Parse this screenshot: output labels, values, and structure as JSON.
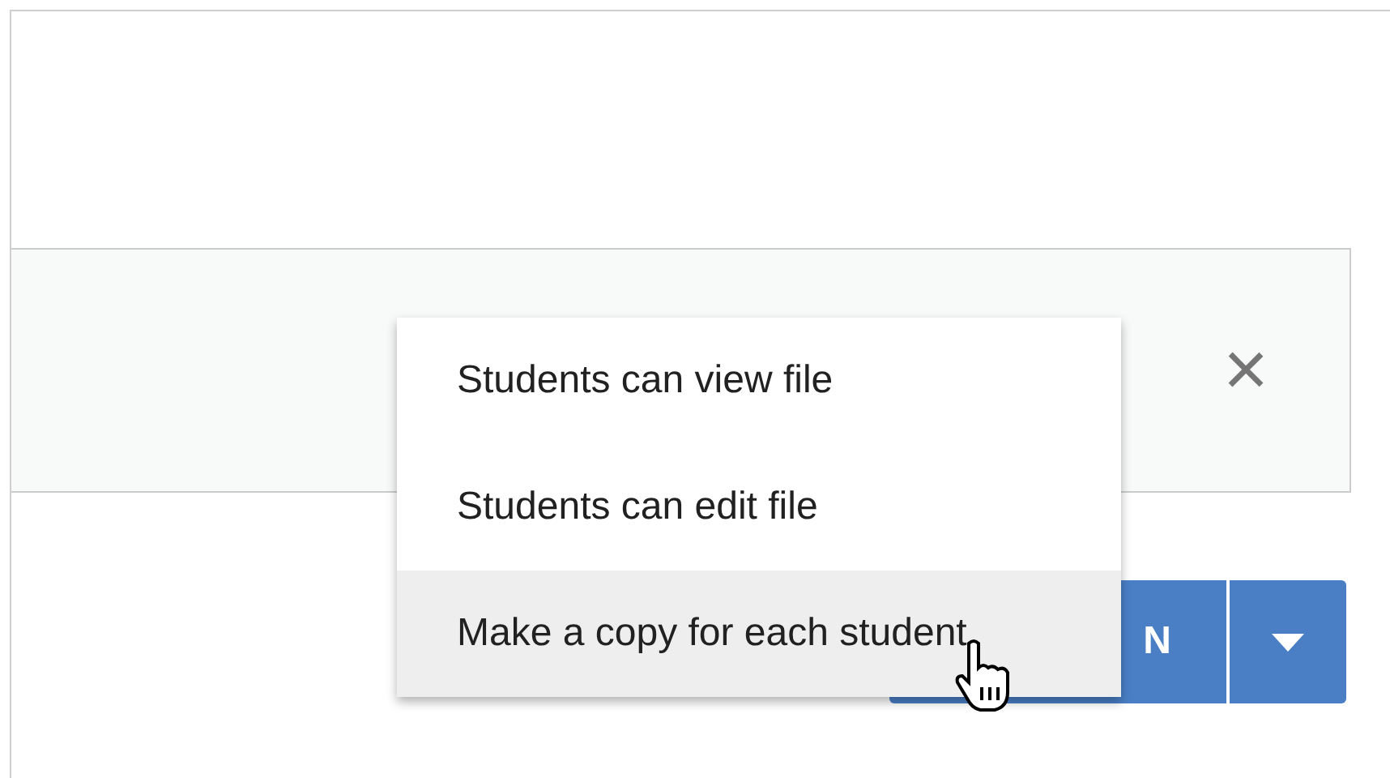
{
  "attachment_bar": {
    "close": "×"
  },
  "assign_button": {
    "label": "N"
  },
  "menu": {
    "items": [
      {
        "label": "Students can view file",
        "selected": false
      },
      {
        "label": "Students can edit file",
        "selected": false
      },
      {
        "label": "Make a copy for each student",
        "selected": true
      }
    ]
  }
}
